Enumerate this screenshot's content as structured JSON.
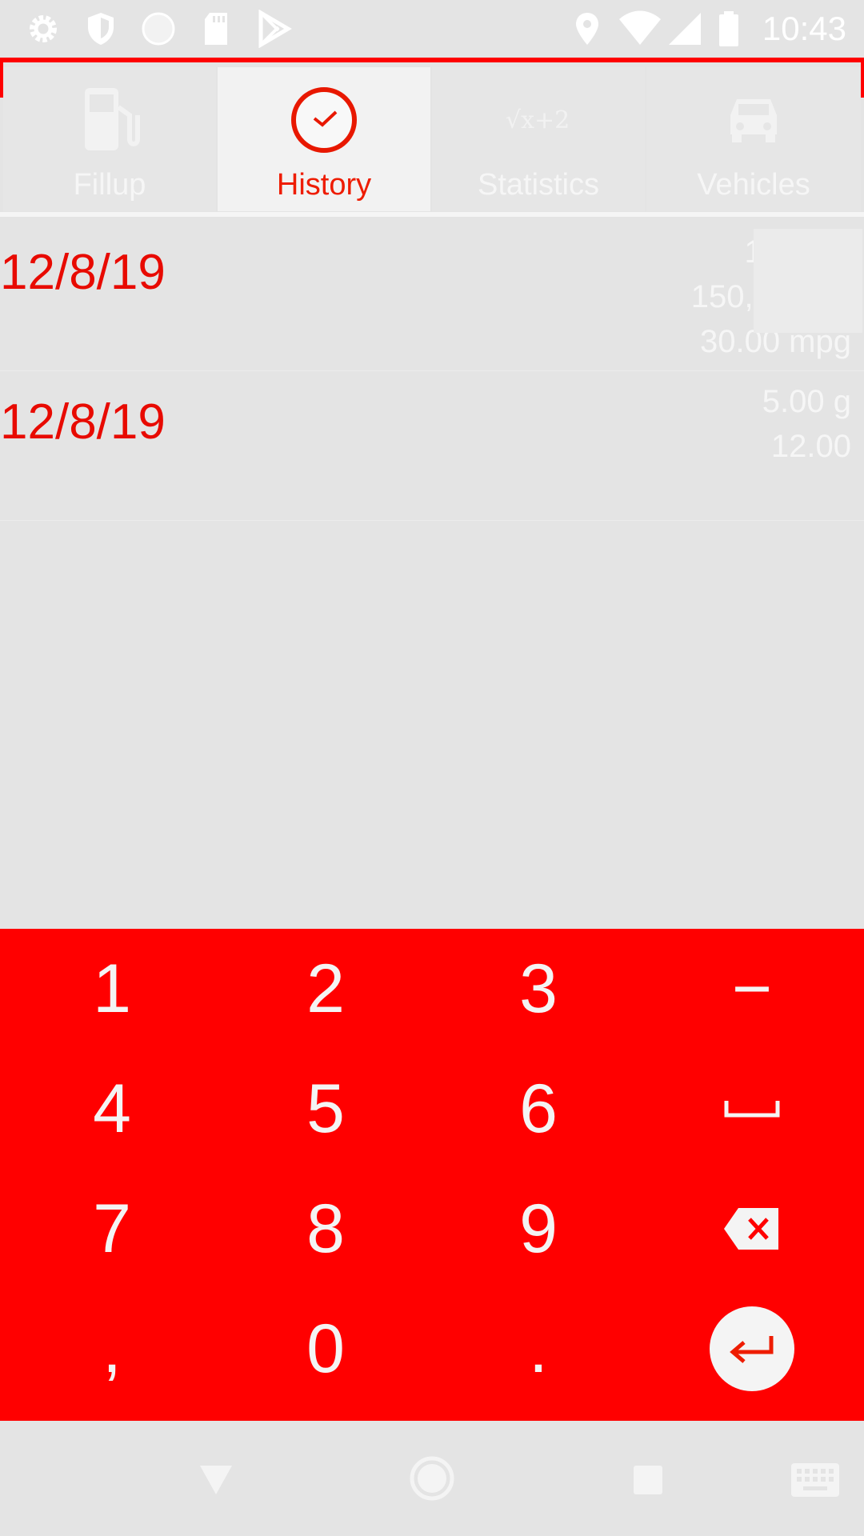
{
  "status_bar": {
    "time": "10:43",
    "left_icons": [
      "settings-icon",
      "shield-icon",
      "circle-icon",
      "sd-card-icon",
      "play-store-icon"
    ],
    "right_icons": [
      "location-icon",
      "wifi-icon",
      "signal-icon",
      "battery-icon"
    ]
  },
  "tabs": [
    {
      "label": "Fillup",
      "icon": "gas-pump-icon",
      "active": false
    },
    {
      "label": "History",
      "icon": "clock-icon",
      "active": true
    },
    {
      "label": "Statistics",
      "icon": "sqrt-formula-icon",
      "active": false
    },
    {
      "label": "Vehicles",
      "icon": "car-icon",
      "active": false
    }
  ],
  "tab_icon_text": {
    "statistics": "√x+2"
  },
  "history": [
    {
      "date": "12/8/19",
      "values": [
        "14.00 g",
        "150,000.00",
        "30.00 mpg"
      ]
    },
    {
      "date": "12/8/19",
      "values": [
        "5.00 g",
        "12.00"
      ]
    }
  ],
  "keypad": {
    "keys": [
      "1",
      "2",
      "3",
      "−",
      "4",
      "5",
      "6",
      "space",
      "7",
      "8",
      "9",
      "backspace",
      ",",
      "0",
      ".",
      " enter"
    ],
    "labels": {
      "k1": "1",
      "k2": "2",
      "k3": "3",
      "minus": "−",
      "k4": "4",
      "k5": "5",
      "k6": "6",
      "k7": "7",
      "k8": "8",
      "k9": "9",
      "comma": ",",
      "k0": "0",
      "dot": "."
    }
  },
  "nav_bar": {
    "icons": [
      "back-icon",
      "home-icon",
      "recents-icon",
      "keyboard-icon"
    ]
  },
  "colors": {
    "accent": "#ff0000",
    "accent_text": "#ee1c00",
    "background": "#e4e4e4",
    "light_text": "#f6f6f6"
  }
}
